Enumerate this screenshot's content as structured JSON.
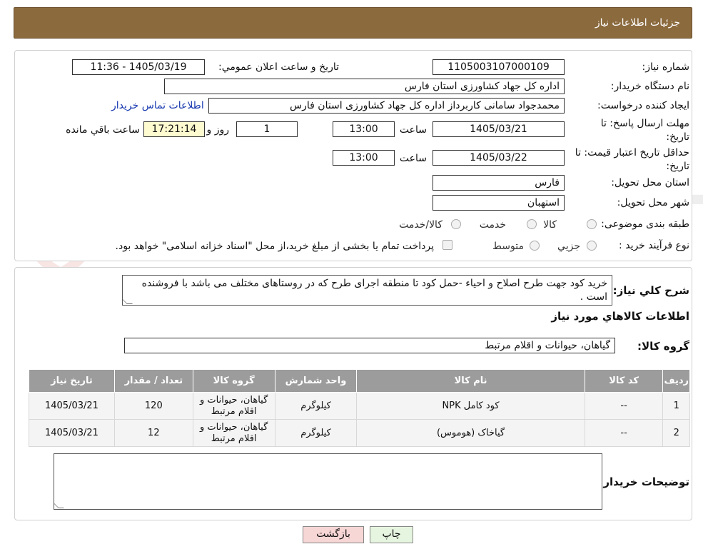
{
  "header": {
    "title": "جزئیات اطلاعات نیاز"
  },
  "form": {
    "need_number_label": "شماره نیاز:",
    "need_number": "1105003107000109",
    "announce_label": "تاریخ و ساعت اعلان عمومي:",
    "announce_value": "1405/03/19 - 11:36",
    "buyer_org_label": "نام دستگاه خريدار:",
    "buyer_org": "اداره کل جهاد کشاورزی استان فارس",
    "creator_label": "ايجاد کننده درخواست:",
    "creator": "محمدجواد سامانی کاربرداز اداره کل جهاد کشاورزی استان فارس",
    "contact_link": "اطلاعات تماس خريدار",
    "deadline_label": "مهلت ارسال پاسخ: تا تاریخ:",
    "deadline_date": "1405/03/21",
    "time_label": "ساعت",
    "deadline_time": "13:00",
    "days_value": "1",
    "days_label": "روز و",
    "remaining_value": "17:21:14",
    "remaining_label": "ساعت باقي مانده",
    "validity_label": "حداقل تاريخ اعتبار قيمت: تا تاریخ:",
    "validity_date": "1405/03/22",
    "validity_time": "13:00",
    "province_label": "استان محل تحويل:",
    "province": "فارس",
    "city_label": "شهر محل تحويل:",
    "city": "استهبان",
    "category_label": "طبقه بندی موضوعی:",
    "category_options": [
      "کالا",
      "خدمت",
      "کالا/خدمت"
    ],
    "process_label": "نوع فرآيند خريد :",
    "process_options": [
      "جزيي",
      "متوسط"
    ],
    "payment_note": "پرداخت تمام يا بخشی از مبلغ خريد،از محل \"اسناد خزانه اسلامی\" خواهد بود."
  },
  "details": {
    "description_label": "شرح کلي نياز:",
    "description": "خريد کود جهت طرح اصلاح و احياء -حمل کود تا منطقه اجرای طرح که در روستاهای مختلف می باشد با فروشنده است .",
    "goods_info_title": "اطلاعات کالاهاي مورد نياز",
    "goods_group_label": "گروه کالا:",
    "goods_group": "گیاهان، حیوانات و اقلام مرتبط"
  },
  "table": {
    "headers": [
      "رديف",
      "کد کالا",
      "نام کالا",
      "واحد شمارش",
      "گروه کالا",
      "تعداد / مقدار",
      "تاريخ نياز"
    ],
    "rows": [
      [
        "1",
        "--",
        "کود کامل NPK",
        "کیلوگرم",
        "گیاهان، حیوانات و اقلام مرتبط",
        "120",
        "1405/03/21"
      ],
      [
        "2",
        "--",
        "گیاخاک (هوموس)",
        "کیلوگرم",
        "گیاهان، حیوانات و اقلام مرتبط",
        "12",
        "1405/03/21"
      ]
    ]
  },
  "buyer_notes": {
    "label": "توضيحات خريدار:",
    "value": ""
  },
  "buttons": {
    "print": "چاپ",
    "back": "بازگشت"
  },
  "colors": {
    "header_bg": "#8b6a3e",
    "table_header_bg": "#9c9c9c",
    "back_button_bg": "#f7d6d6",
    "print_button_bg": "#e6f5e0"
  }
}
